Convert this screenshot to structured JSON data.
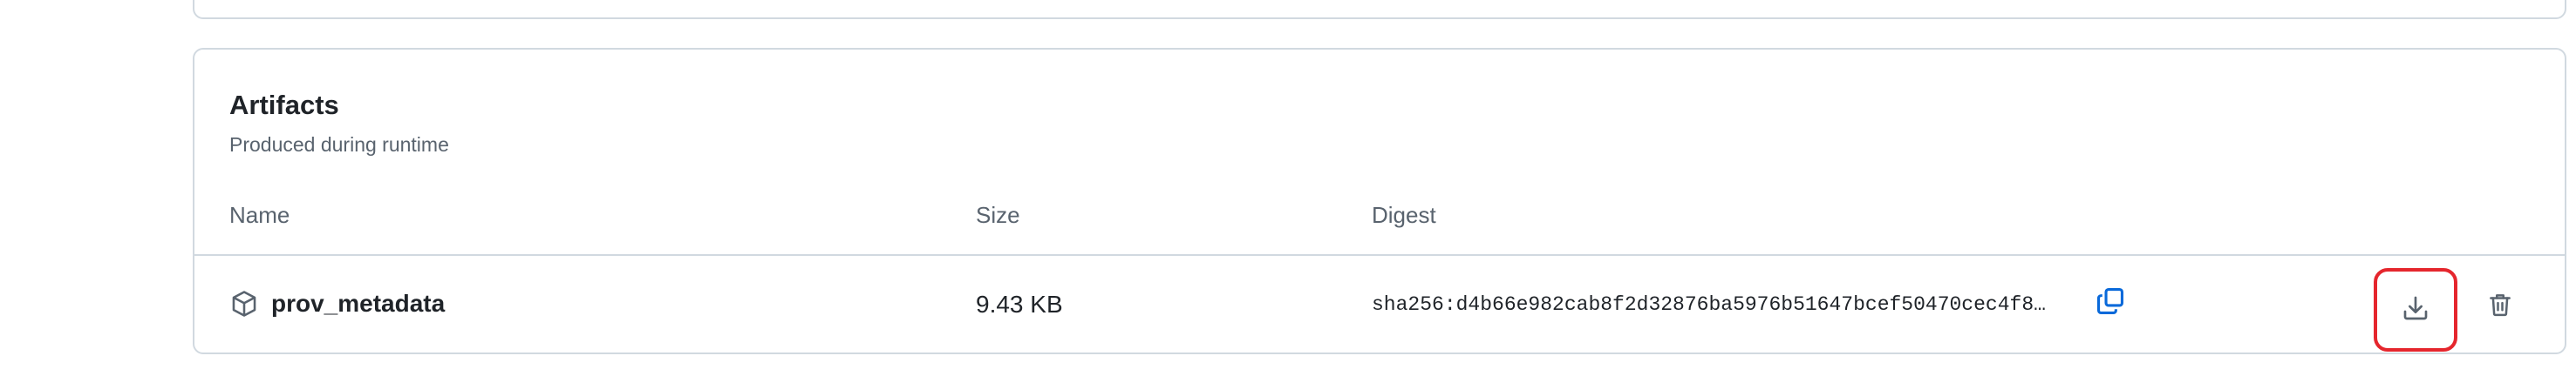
{
  "artifacts": {
    "title": "Artifacts",
    "subtitle": "Produced during runtime",
    "columns": {
      "name": "Name",
      "size": "Size",
      "digest": "Digest"
    },
    "rows": [
      {
        "name": "prov_metadata",
        "size": "9.43 KB",
        "digest": "sha256:d4b66e982cab8f2d32876ba5976b51647bcef50470cec4f8…"
      }
    ]
  },
  "icons": {
    "artifact": "package-icon",
    "copy": "copy-icon",
    "download": "download-icon",
    "delete": "trash-icon"
  },
  "colors": {
    "border": "#d1d9e0",
    "muted_text": "#59636e",
    "copy_icon": "#0969da",
    "highlight": "#e5262d"
  }
}
